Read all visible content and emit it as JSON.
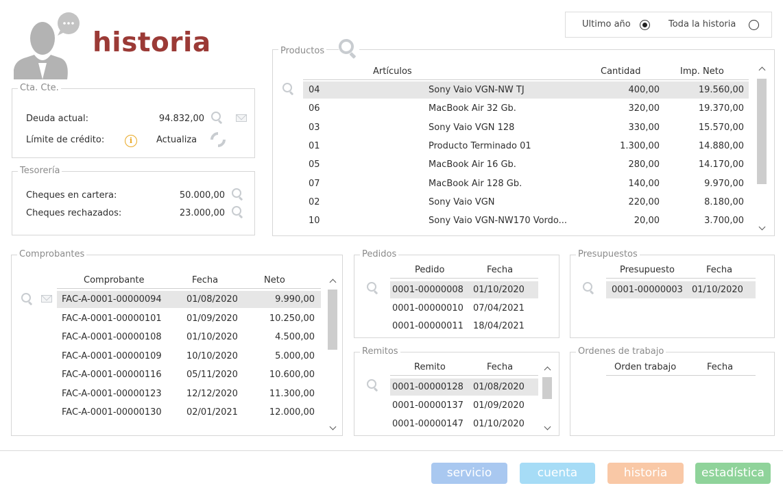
{
  "page": {
    "title": "historia",
    "filters": {
      "last_year": "Ultimo año",
      "all_history": "Toda la historia"
    }
  },
  "cta": {
    "legend": "Cta. Cte.",
    "debt_label": "Deuda actual:",
    "debt_value": "94.832,00",
    "credit_label": "Límite de crédito:",
    "credit_action": "Actualiza"
  },
  "tesoreria": {
    "legend": "Tesorería",
    "portfolio_label": "Cheques en cartera:",
    "portfolio_value": "50.000,00",
    "rejected_label": "Cheques rechazados:",
    "rejected_value": "23.000,00"
  },
  "productos": {
    "legend": "Productos",
    "columns": [
      "Artículos",
      "Cantidad",
      "Imp. Neto"
    ],
    "rows": [
      [
        "04",
        "Sony Vaio VGN-NW TJ",
        "400,00",
        "19.560,00"
      ],
      [
        "06",
        "MacBook Air 32 Gb.",
        "320,00",
        "19.370,00"
      ],
      [
        "03",
        "Sony Vaio VGN 128",
        "330,00",
        "15.570,00"
      ],
      [
        "01",
        "Producto Terminado 01",
        "1.300,00",
        "14.880,00"
      ],
      [
        "05",
        "MacBook Air 16 Gb.",
        "280,00",
        "14.170,00"
      ],
      [
        "07",
        "MacBook Air 128 Gb.",
        "140,00",
        "9.970,00"
      ],
      [
        "02",
        "Sony Vaio VGN",
        "220,00",
        "8.180,00"
      ],
      [
        "10",
        "Sony Vaio VGN-NW170 Vordo...",
        "20,00",
        "3.700,00"
      ]
    ]
  },
  "comprobantes": {
    "legend": "Comprobantes",
    "columns": [
      "Comprobante",
      "Fecha",
      "Neto"
    ],
    "rows": [
      [
        "FAC-A-0001-00000094",
        "01/08/2020",
        "9.990,00"
      ],
      [
        "FAC-A-0001-00000101",
        "01/09/2020",
        "10.250,00"
      ],
      [
        "FAC-A-0001-00000108",
        "01/10/2020",
        "4.500,00"
      ],
      [
        "FAC-A-0001-00000109",
        "10/10/2020",
        "5.000,00"
      ],
      [
        "FAC-A-0001-00000116",
        "05/11/2020",
        "10.600,00"
      ],
      [
        "FAC-A-0001-00000123",
        "12/12/2020",
        "11.300,00"
      ],
      [
        "FAC-A-0001-00000130",
        "02/01/2021",
        "12.000,00"
      ]
    ]
  },
  "pedidos": {
    "legend": "Pedidos",
    "columns": [
      "Pedido",
      "Fecha"
    ],
    "rows": [
      [
        "0001-00000008",
        "01/10/2020"
      ],
      [
        "0001-00000010",
        "07/04/2021"
      ],
      [
        "0001-00000011",
        "18/04/2021"
      ]
    ]
  },
  "presupuestos": {
    "legend": "Presupuestos",
    "columns": [
      "Presupuesto",
      "Fecha"
    ],
    "rows": [
      [
        "0001-00000003",
        "01/10/2020"
      ]
    ]
  },
  "remitos": {
    "legend": "Remitos",
    "columns": [
      "Remito",
      "Fecha"
    ],
    "rows": [
      [
        "0001-00000128",
        "01/08/2020"
      ],
      [
        "0001-00000137",
        "01/09/2020"
      ],
      [
        "0001-00000147",
        "01/10/2020"
      ]
    ]
  },
  "ordenes": {
    "legend": "Ordenes de trabajo",
    "columns": [
      "Orden trabajo",
      "Fecha"
    ]
  },
  "nav": {
    "servicio": "servicio",
    "cuenta": "cuenta",
    "historia": "historia",
    "estadistica": "estadística"
  },
  "colors": {
    "title": "#9b3a36",
    "servicio": "#a9c8f0",
    "cuenta": "#a6dcf6",
    "historia": "#f9c8a6",
    "estadistica": "#8fd39a"
  }
}
